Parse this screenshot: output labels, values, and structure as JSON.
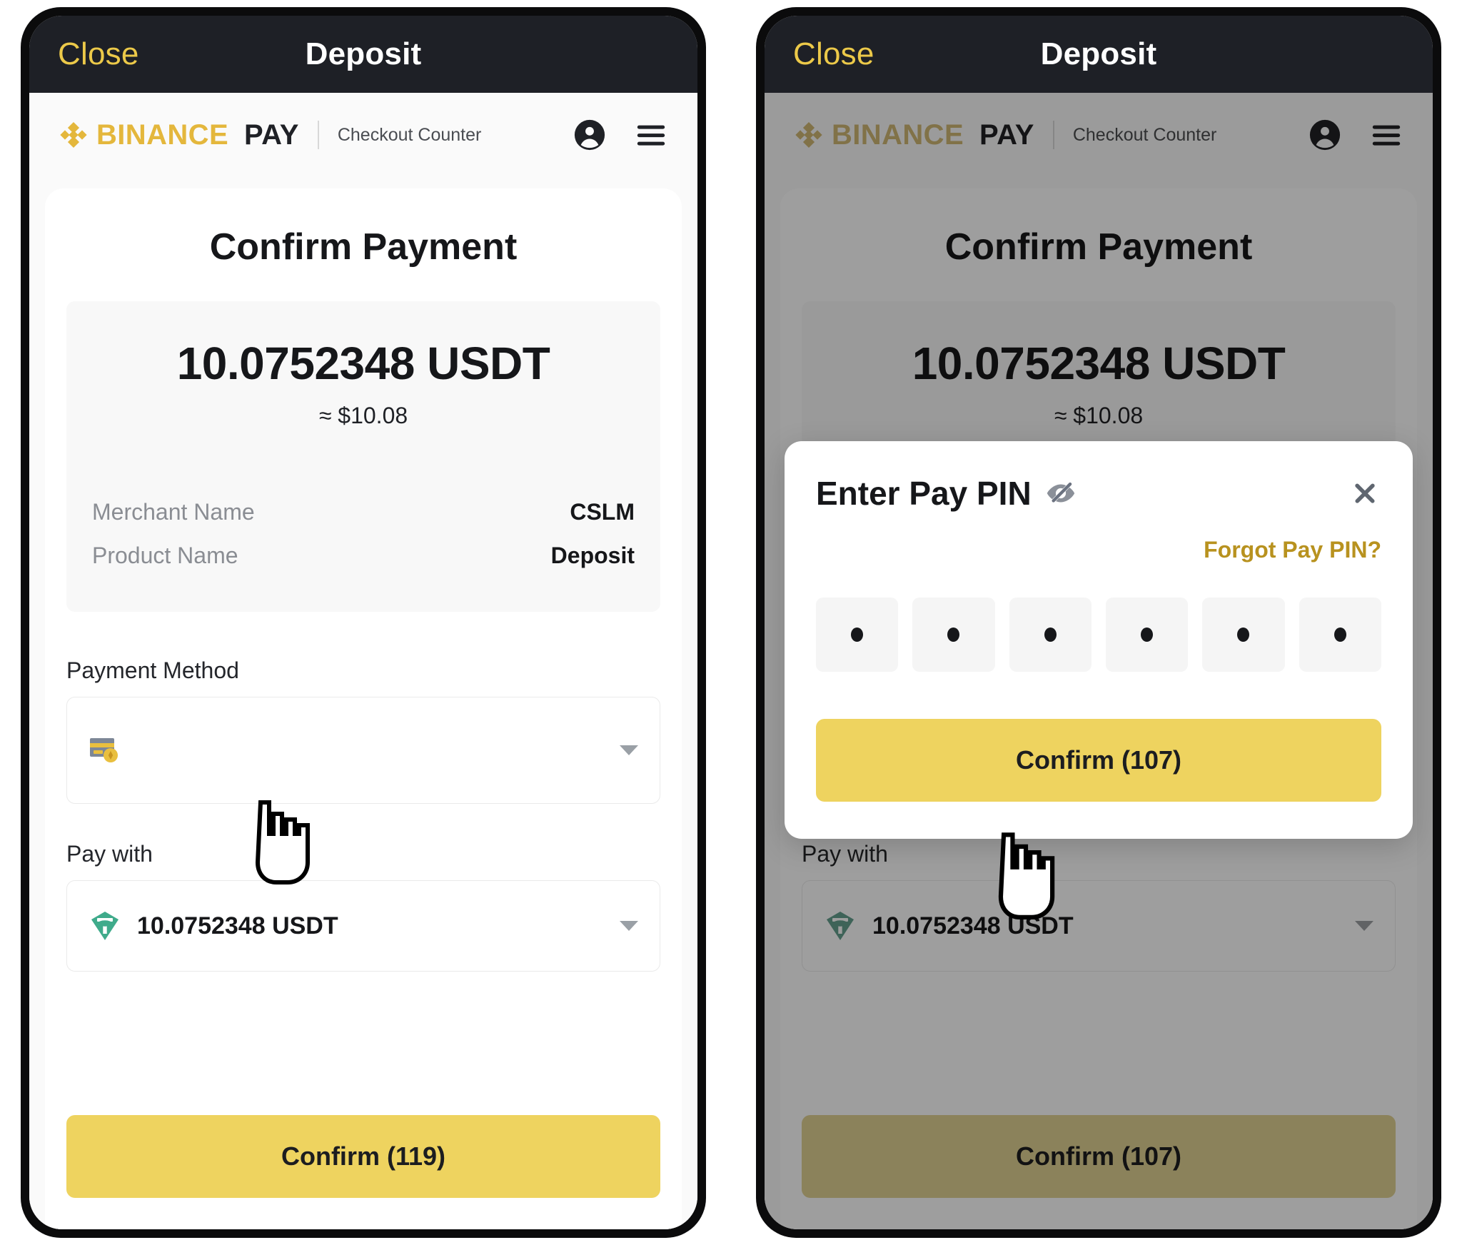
{
  "navbar": {
    "close_label": "Close",
    "title": "Deposit"
  },
  "brand": {
    "binance_text": "BINANCE",
    "pay_text": "PAY",
    "subtitle": "Checkout Counter",
    "account_icon": "account-circle-icon",
    "menu_icon": "hamburger-menu-icon"
  },
  "checkout": {
    "title": "Confirm Payment",
    "amount": "10.0752348 USDT",
    "amount_fiat": "≈ $10.08",
    "details": [
      {
        "key": "Merchant Name",
        "value": "CSLM"
      },
      {
        "key": "Product Name",
        "value": "Deposit"
      }
    ],
    "payment_method": {
      "label": "Payment Method",
      "icon": "credit-card-coin-icon",
      "value": ""
    },
    "pay_with": {
      "label": "Pay with",
      "icon": "tether-usdt-icon",
      "value": "10.0752348 USDT"
    },
    "confirm_label_left": "Confirm (119)",
    "confirm_label_right": "Confirm (107)"
  },
  "pin_modal": {
    "title": "Enter Pay PIN",
    "visibility_icon": "eye-off-icon",
    "close_icon": "close-x-icon",
    "forgot_label": "Forgot Pay PIN?",
    "pin_length": 6,
    "pin_filled": [
      true,
      true,
      true,
      true,
      true,
      true
    ],
    "confirm_label": "Confirm (107)"
  },
  "colors": {
    "brand_gold": "#e4b73c",
    "cta_yellow": "#eed35f",
    "navbar_dark": "#1e2026",
    "close_gold": "#ecc949",
    "link_gold": "#b8921f",
    "tether_green": "#2e9e7e"
  }
}
